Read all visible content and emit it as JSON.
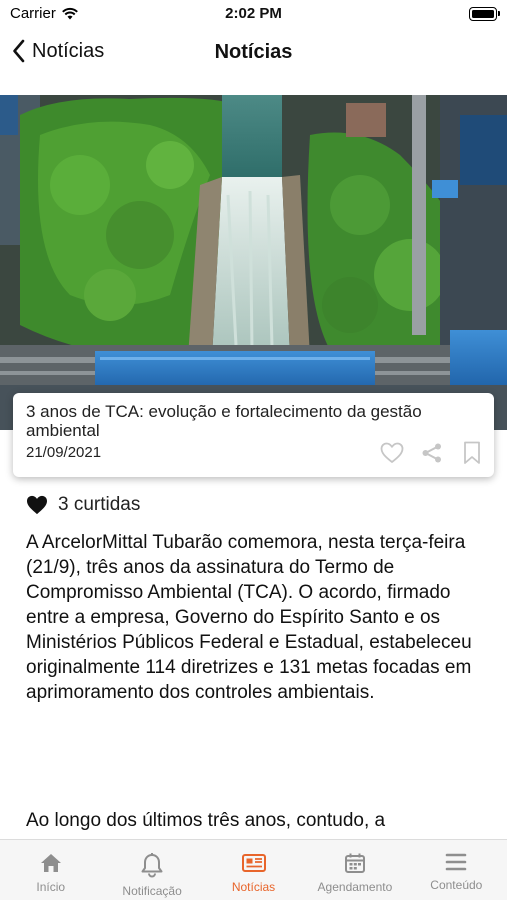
{
  "status_bar": {
    "carrier": "Carrier",
    "time": "2:02 PM"
  },
  "nav": {
    "back_label": "Notícias",
    "title": "Notícias"
  },
  "article": {
    "title": "3 anos de TCA: evolução e fortalecimento da gestão ambiental",
    "date": "21/09/2021",
    "likes": "3 curtidas",
    "paragraph_1": "A ArcelorMittal Tubarão comemora, nesta terça-feira (21/9), três anos da assinatura do Termo de Compromisso Ambiental (TCA). O acordo, firmado entre a empresa, Governo do Espírito Santo e os Ministérios Públicos Federal e Estadual, estabeleceu originalmente 114 diretrizes e 131 metas focadas em aprimoramento dos controles ambientais.",
    "paragraph_2": "Ao longo dos últimos três anos, contudo, a"
  },
  "tabs": [
    {
      "label": "Início",
      "icon": "home-icon",
      "active": false
    },
    {
      "label": "Notificação",
      "icon": "bell-icon",
      "active": false
    },
    {
      "label": "Notícias",
      "icon": "newspaper-icon",
      "active": true
    },
    {
      "label": "Agendamento",
      "icon": "calendar-icon",
      "active": false
    },
    {
      "label": "Conteúdo",
      "icon": "menu-icon",
      "active": false
    }
  ],
  "colors": {
    "accent": "#e8652b",
    "inactive": "#8e8e8e",
    "tab_bar": "#f6f6f6"
  }
}
